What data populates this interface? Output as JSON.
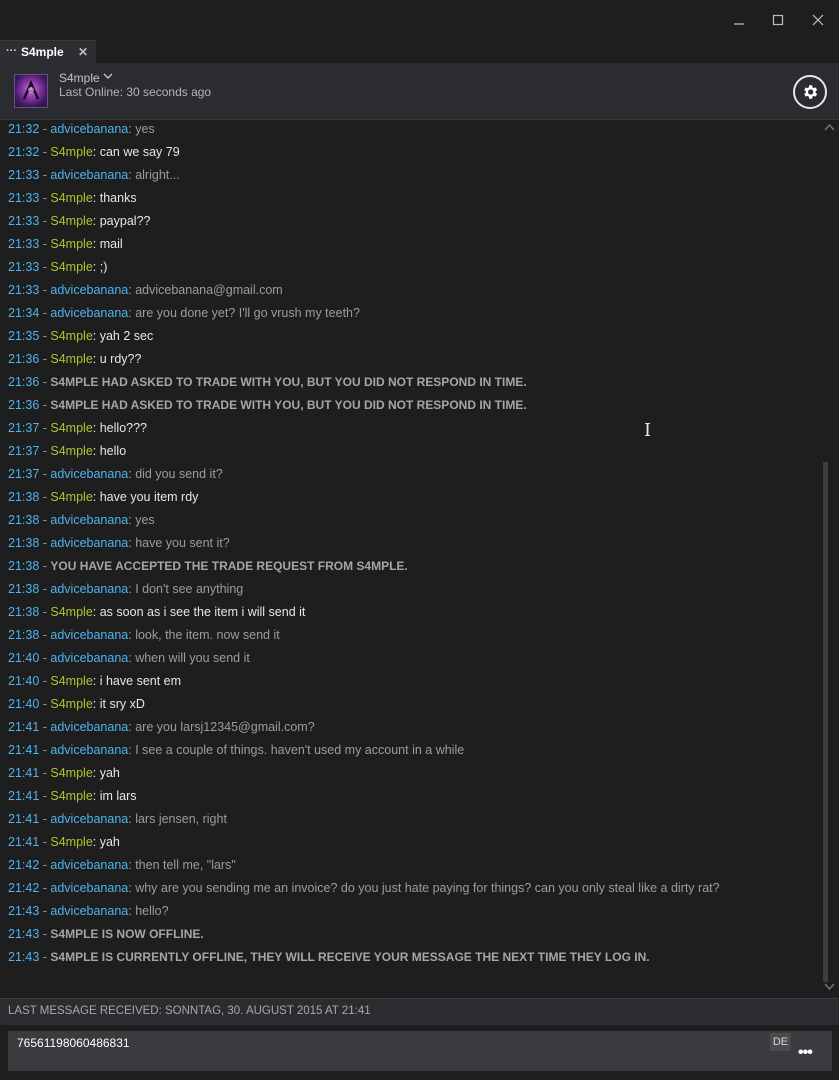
{
  "window": {
    "minimize_icon": "minimize-icon",
    "maximize_icon": "maximize-icon",
    "close_icon": "close-icon"
  },
  "tab": {
    "dots": "···",
    "name": "S4mple",
    "close": "✕"
  },
  "header": {
    "contact_name": "S4mple",
    "chevron": "⌄",
    "last_online": "Last Online: 30 seconds ago",
    "settings_icon": "gear-icon"
  },
  "colors": {
    "timestamp": "#4eb3f0",
    "me": "#4eb3f0",
    "friend": "#a5c833",
    "background": "#1e1e1e"
  },
  "messages": [
    {
      "time": "21:32",
      "user": "advicebanana",
      "role": "me",
      "text": "yes"
    },
    {
      "time": "21:32",
      "user": "S4mple",
      "role": "friend",
      "text": "can we say 79"
    },
    {
      "time": "21:33",
      "user": "advicebanana",
      "role": "me",
      "text": "alright..."
    },
    {
      "time": "21:33",
      "user": "S4mple",
      "role": "friend",
      "text": "thanks"
    },
    {
      "time": "21:33",
      "user": "S4mple",
      "role": "friend",
      "text": "paypal??"
    },
    {
      "time": "21:33",
      "user": "S4mple",
      "role": "friend",
      "text": "mail"
    },
    {
      "time": "21:33",
      "user": "S4mple",
      "role": "friend",
      "text": ";)"
    },
    {
      "time": "21:33",
      "user": "advicebanana",
      "role": "me",
      "text": "advicebanana@gmail.com"
    },
    {
      "time": "21:34",
      "user": "advicebanana",
      "role": "me",
      "text": "are you done yet? I'll go vrush my teeth?"
    },
    {
      "time": "21:35",
      "user": "S4mple",
      "role": "friend",
      "text": "yah 2 sec"
    },
    {
      "time": "21:36",
      "user": "S4mple",
      "role": "friend",
      "text": "u rdy??"
    },
    {
      "time": "21:36",
      "role": "system",
      "text": "S4MPLE HAD ASKED TO TRADE WITH YOU, BUT YOU DID NOT RESPOND IN TIME."
    },
    {
      "time": "21:36",
      "role": "system",
      "text": "S4MPLE HAD ASKED TO TRADE WITH YOU, BUT YOU DID NOT RESPOND IN TIME."
    },
    {
      "time": "21:37",
      "user": "S4mple",
      "role": "friend",
      "text": "hello???"
    },
    {
      "time": "21:37",
      "user": "S4mple",
      "role": "friend",
      "text": "hello"
    },
    {
      "time": "21:37",
      "user": "advicebanana",
      "role": "me",
      "text": "did you send it?"
    },
    {
      "time": "21:38",
      "user": "S4mple",
      "role": "friend",
      "text": "have you item rdy"
    },
    {
      "time": "21:38",
      "user": "advicebanana",
      "role": "me",
      "text": "yes"
    },
    {
      "time": "21:38",
      "user": "advicebanana",
      "role": "me",
      "text": "have you sent it?"
    },
    {
      "time": "21:38",
      "role": "system",
      "text": "YOU HAVE ACCEPTED THE TRADE REQUEST FROM S4MPLE."
    },
    {
      "time": "21:38",
      "user": "advicebanana",
      "role": "me",
      "text": "I don't see anything"
    },
    {
      "time": "21:38",
      "user": "S4mple",
      "role": "friend",
      "text": "as soon as i see the item i will send it"
    },
    {
      "time": "21:38",
      "user": "advicebanana",
      "role": "me",
      "text": "look, the item. now send it"
    },
    {
      "time": "21:40",
      "user": "advicebanana",
      "role": "me",
      "text": "when will you send it"
    },
    {
      "time": "21:40",
      "user": "S4mple",
      "role": "friend",
      "text": "i have sent em"
    },
    {
      "time": "21:40",
      "user": "S4mple",
      "role": "friend",
      "text": "it sry xD"
    },
    {
      "time": "21:41",
      "user": "advicebanana",
      "role": "me",
      "text": "are you larsj12345@gmail.com?"
    },
    {
      "time": "21:41",
      "user": "advicebanana",
      "role": "me",
      "text": "I see a couple of things. haven't used my account in a while"
    },
    {
      "time": "21:41",
      "user": "S4mple",
      "role": "friend",
      "text": "yah"
    },
    {
      "time": "21:41",
      "user": "S4mple",
      "role": "friend",
      "text": "im lars"
    },
    {
      "time": "21:41",
      "user": "advicebanana",
      "role": "me",
      "text": "lars jensen, right"
    },
    {
      "time": "21:41",
      "user": "S4mple",
      "role": "friend",
      "text": "yah"
    },
    {
      "time": "21:42",
      "user": "advicebanana",
      "role": "me",
      "text": "then tell me, \"lars\""
    },
    {
      "time": "21:42",
      "user": "advicebanana",
      "role": "me",
      "text": "why are you sending me an invoice? do you just hate paying for things? can you only steal like a dirty rat?"
    },
    {
      "time": "21:43",
      "user": "advicebanana",
      "role": "me",
      "text": "hello?"
    },
    {
      "time": "21:43",
      "role": "system",
      "text": "S4MPLE IS NOW OFFLINE."
    },
    {
      "time": "21:43",
      "role": "system",
      "text": "S4MPLE IS CURRENTLY OFFLINE, THEY WILL RECEIVE YOUR MESSAGE THE NEXT TIME THEY LOG IN."
    }
  ],
  "footer": {
    "last_received": "LAST MESSAGE RECEIVED: SONNTAG, 30. AUGUST 2015 AT 21:41"
  },
  "input": {
    "value": "76561198060486831",
    "language": "DE",
    "more": "•••"
  },
  "scrollbar": {
    "up_icon": "chevron-up-icon",
    "down_icon": "chevron-down-icon"
  }
}
